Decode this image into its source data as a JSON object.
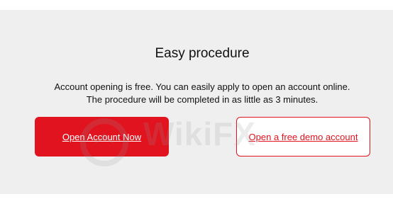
{
  "section": {
    "title": "Easy procedure",
    "description_line1": "Account opening is free. You can easily apply to open an account online.",
    "description_line2": "The procedure will be completed in as little as 3 minutes."
  },
  "buttons": {
    "open_account_label": "Open Account Now",
    "demo_account_label": "Open a free demo account"
  },
  "watermark": {
    "text": "WikiFX",
    "icon": "wikifx-logo-icon"
  },
  "colors": {
    "accent": "#e1131f",
    "panel_bg": "#efefef",
    "text": "#111111"
  }
}
